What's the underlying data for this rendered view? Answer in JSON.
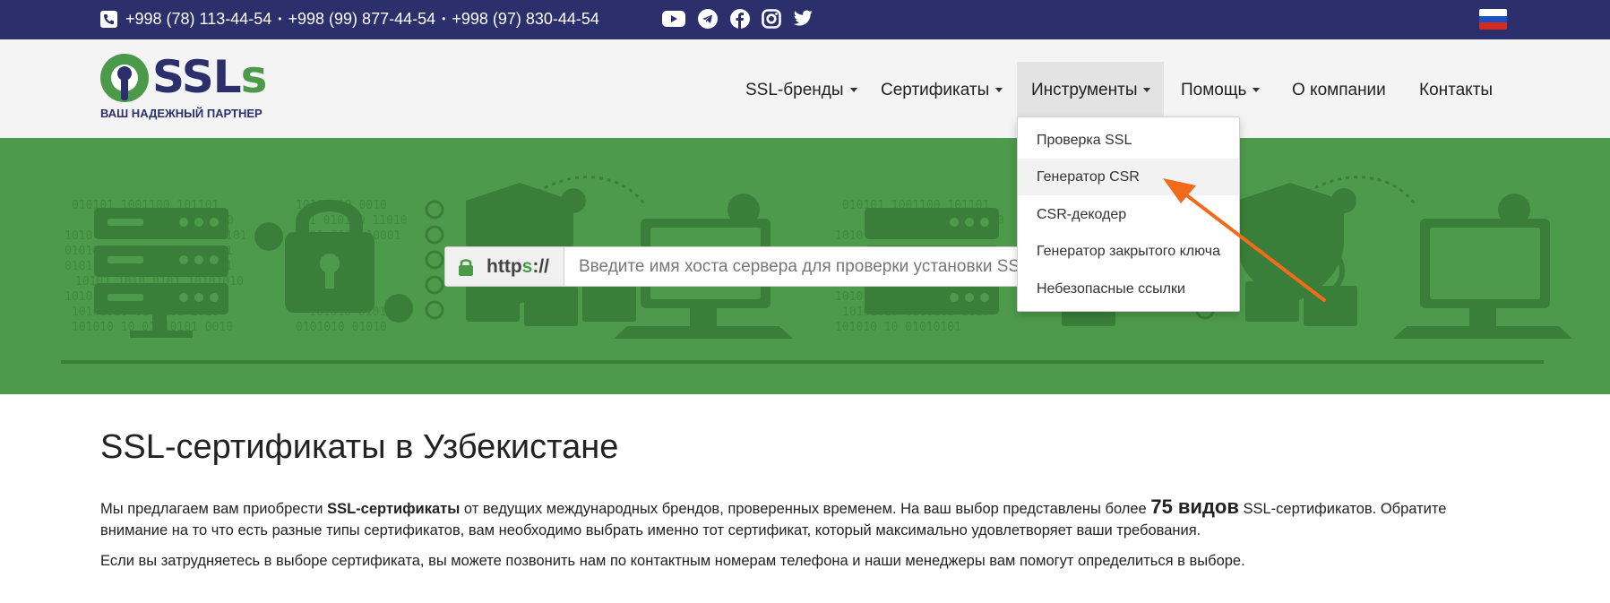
{
  "topbar": {
    "phones": [
      "+998 (78) 113-44-54",
      "+998 (99) 877-44-54",
      "+998 (97) 830-44-54"
    ],
    "separator": "•",
    "social": [
      "youtube-icon",
      "telegram-icon",
      "facebook-icon",
      "instagram-icon",
      "twitter-icon"
    ],
    "language_flag": "russia-flag"
  },
  "logo": {
    "name_main": "SSL",
    "name_accent": "s",
    "tagline": "ВАШ НАДЕЖНЫЙ ПАРТНЕР"
  },
  "nav": {
    "items": [
      {
        "label": "SSL-бренды",
        "dropdown": true
      },
      {
        "label": "Сертификаты",
        "dropdown": true
      },
      {
        "label": "Инструменты",
        "dropdown": true
      },
      {
        "label": "Помощь",
        "dropdown": true
      },
      {
        "label": "О компании",
        "dropdown": false
      },
      {
        "label": "Контакты",
        "dropdown": false
      }
    ],
    "open_menu": "Инструменты",
    "dropdown_items": [
      "Проверка SSL",
      "Генератор CSR",
      "CSR-декодер",
      "Генератор закрытого ключа",
      "Небезопасные ссылки"
    ],
    "highlighted_item": "Генератор CSR"
  },
  "search": {
    "prefix_dark": "http",
    "prefix_green": "s",
    "prefix_tail": "://",
    "placeholder": "Введите имя хоста сервера для проверки установки SSL"
  },
  "content": {
    "heading": "SSL-сертификаты в Узбекистане",
    "p1_a": "Мы предлагаем вам приобрести ",
    "p1_b": "SSL-сертификаты",
    "p1_c": " от ведущих международных брендов, проверенных временем. На ваш выбор представлены более ",
    "p1_d": "75 видов",
    "p1_e": " SSL-сертификатов. Обратите внимание на то что есть разные типы сертификатов, вам необходимо выбрать именно тот сертификат, который максимально удовлетворяет ваши требования.",
    "p2": "Если вы затрудняетесь в выборе сертификата, вы можете позвонить нам по контактным номерам телефона и наши менеджеры вам помогут определиться в выборе."
  },
  "colors": {
    "topbar": "#2b2f6b",
    "brand_green": "#4a9a4a",
    "hero": "#4e9a4c",
    "annotation_arrow": "#f26a1b"
  }
}
